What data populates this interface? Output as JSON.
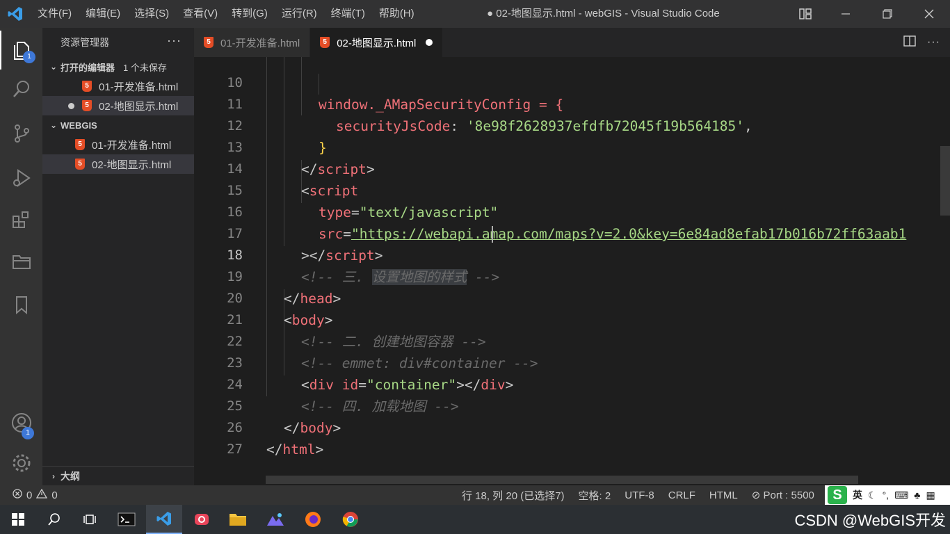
{
  "titlebar": {
    "menu": [
      "文件(F)",
      "编辑(E)",
      "选择(S)",
      "查看(V)",
      "转到(G)",
      "运行(R)",
      "终端(T)",
      "帮助(H)"
    ],
    "title": "● 02-地图显示.html - webGIS - Visual Studio Code"
  },
  "activity": {
    "explorer_badge": "1",
    "accounts_badge": "1"
  },
  "sidebar": {
    "header": "资源管理器",
    "more": "···",
    "open_editors": {
      "title": "打开的编辑器",
      "unsaved": "1 个未保存",
      "files": [
        "01-开发准备.html",
        "02-地图显示.html"
      ]
    },
    "project": {
      "title": "WEBGIS",
      "files": [
        "01-开发准备.html",
        "02-地图显示.html"
      ]
    },
    "outline": "大纲"
  },
  "tabs": [
    {
      "label": "01-开发准备.html"
    },
    {
      "label": "02-地图显示.html"
    }
  ],
  "editor": {
    "line_numbers": [
      "10",
      "11",
      "12",
      "13",
      "14",
      "15",
      "16",
      "17",
      "18",
      "19",
      "20",
      "21",
      "22",
      "23",
      "24",
      "25",
      "26",
      "27"
    ],
    "active_line": "18",
    "lines": {
      "l10": "window._AMapSecurityConfig = {",
      "l11_key": "securityJsCode",
      "l11_val": "'8e98f2628937efdfb72045f19b564185'",
      "l12": "}",
      "l13": "script",
      "l14": "script",
      "l15_attr": "type",
      "l15_val": "\"text/javascript\"",
      "l16_attr": "src",
      "l16_val": "\"https://webapi.amap.com/maps?v=2.0&key=6e84ad8efab17b016b72ff63aab1",
      "l17": "script",
      "l18_a": "<!-- 三. ",
      "l18_sel": "设置地图的样式",
      "l18_b": " -->",
      "l19": "head",
      "l20": "body",
      "l21": "<!-- 二. 创建地图容器 -->",
      "l22": "<!-- emmet: div#container -->",
      "l23_tag": "div",
      "l23_attr": "id",
      "l23_val": "\"container\"",
      "l24": "<!-- 四. 加载地图 -->",
      "l25": "body",
      "l26": "html"
    }
  },
  "statusbar": {
    "errors": "0",
    "warnings": "0",
    "position": "行 18, 列 20 (已选择7)",
    "spaces": "空格: 2",
    "encoding": "UTF-8",
    "eol": "CRLF",
    "language": "HTML",
    "port": "Port : 5500",
    "ime_lang": "英"
  },
  "taskbar": {
    "watermark": "CSDN @WebGIS开发"
  },
  "colors": {
    "accent": "#007acc",
    "html_icon": "#e44d26",
    "string": "#a6d785",
    "tag": "#f07178"
  }
}
